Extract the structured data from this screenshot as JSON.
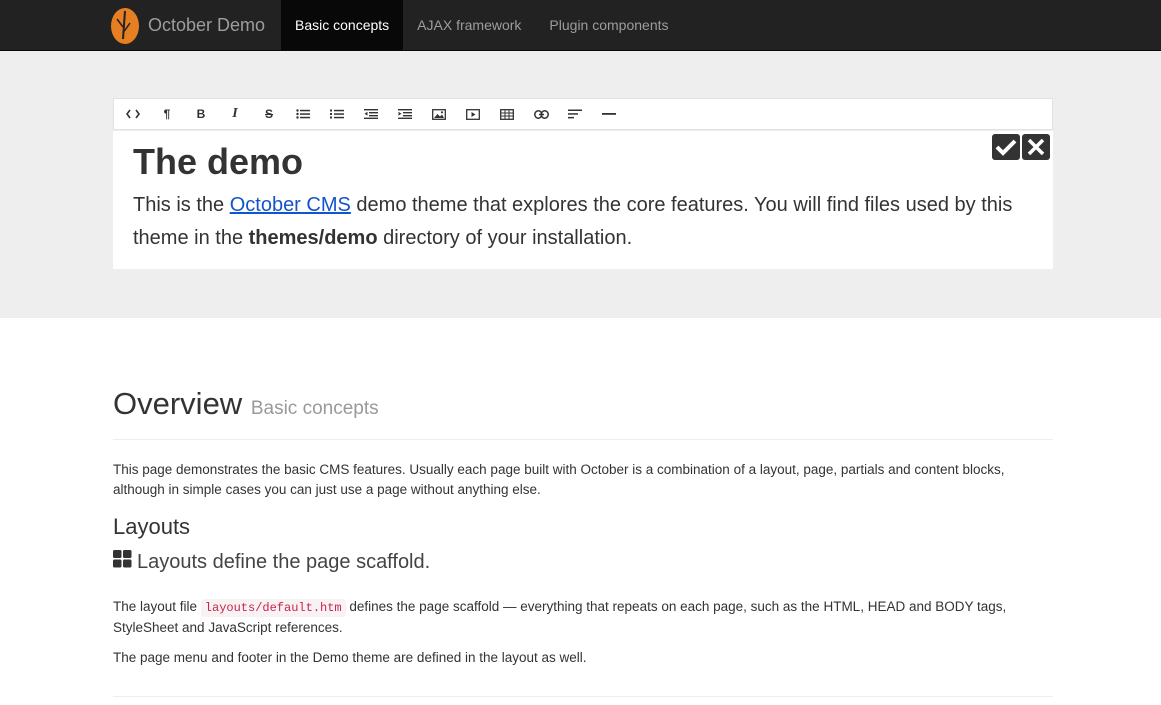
{
  "navbar": {
    "brand": "October Demo",
    "items": [
      {
        "label": "Basic concepts",
        "active": true
      },
      {
        "label": "AJAX framework",
        "active": false
      },
      {
        "label": "Plugin components",
        "active": false
      }
    ]
  },
  "toolbar": {
    "buttons": [
      {
        "icon": "html-code-icon"
      },
      {
        "icon": "paragraph-icon",
        "glyph": "¶"
      },
      {
        "icon": "bold-icon",
        "glyph": "B"
      },
      {
        "icon": "italic-icon",
        "glyph": "I"
      },
      {
        "icon": "strikethrough-icon",
        "glyph": "S"
      },
      {
        "icon": "unordered-list-icon"
      },
      {
        "icon": "ordered-list-icon"
      },
      {
        "icon": "outdent-icon"
      },
      {
        "icon": "indent-icon"
      },
      {
        "icon": "image-icon"
      },
      {
        "icon": "video-icon"
      },
      {
        "icon": "table-icon"
      },
      {
        "icon": "link-icon"
      },
      {
        "icon": "align-icon"
      },
      {
        "icon": "horizontal-rule-icon"
      }
    ]
  },
  "editor": {
    "heading": "The demo",
    "text_before_link": "This is the ",
    "link_text": "October CMS",
    "text_after_link": " demo theme that explores the core features. You will find files used by this theme in the ",
    "bold_text": "themes/demo",
    "text_end": " directory of your installation."
  },
  "content": {
    "title": "Overview",
    "subtitle": "Basic concepts",
    "intro": "This page demonstrates the basic CMS features. Usually each page built with October is a combination of a layout, page, partials and content blocks, although in simple cases you can just use a page without anything else.",
    "layouts_heading": "Layouts",
    "layouts_lead": "Layouts define the page scaffold.",
    "p1_before": "The layout file ",
    "p1_code": "layouts/default.htm",
    "p1_after": " defines the page scaffold — everything that repeats on each page, such as the HTML, HEAD and BODY tags, StyleSheet and JavaScript references.",
    "p2": "The page menu and footer in the Demo theme are defined in the layout as well."
  },
  "colors": {
    "navbar_bg": "#222222",
    "accent_logo": "#e67e22",
    "link": "#1155cc",
    "code": "#c7254e"
  }
}
